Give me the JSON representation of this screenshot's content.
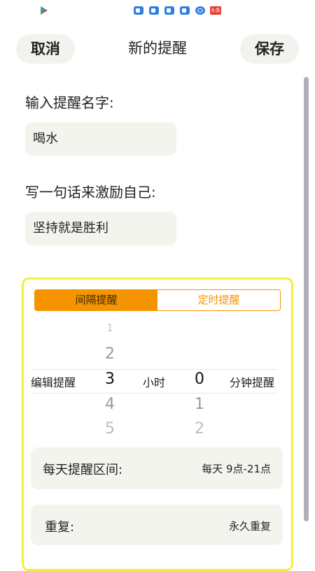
{
  "header": {
    "cancel_label": "取消",
    "title": "新的提醒",
    "save_label": "保存"
  },
  "status_bar": {
    "icons": [
      "play-store-icon",
      "camera-icon",
      "camera-icon",
      "camera-icon",
      "camera-icon",
      "browser-icon",
      "news-app-icon"
    ],
    "red_badge_text": "头条"
  },
  "name_section": {
    "label": "输入提醒名字:",
    "value": "喝水"
  },
  "motto_section": {
    "label": "写一句话来激励自己:",
    "value": "坚持就是胜利"
  },
  "mode_tabs": [
    {
      "label": "间隔提醒",
      "active": true
    },
    {
      "label": "定时提醒",
      "active": false
    }
  ],
  "picker": {
    "left_label": "编辑提醒",
    "hours_above": [
      "1",
      "2"
    ],
    "hours_selected": "3",
    "hours_below": [
      "4",
      "5"
    ],
    "hours_unit": "小时",
    "minutes_selected": "0",
    "minutes_below": [
      "1",
      "2"
    ],
    "minutes_unit": "分钟提醒"
  },
  "daily_range": {
    "label": "每天提醒区间:",
    "value": "每天 9点-21点"
  },
  "repeat": {
    "label": "重复:",
    "value": "永久重复"
  },
  "colors": {
    "accent": "#f59400",
    "panel_border": "#f4ef3a",
    "field_bg": "#f4f4ef",
    "scrollbar": "#b0b0bd"
  }
}
